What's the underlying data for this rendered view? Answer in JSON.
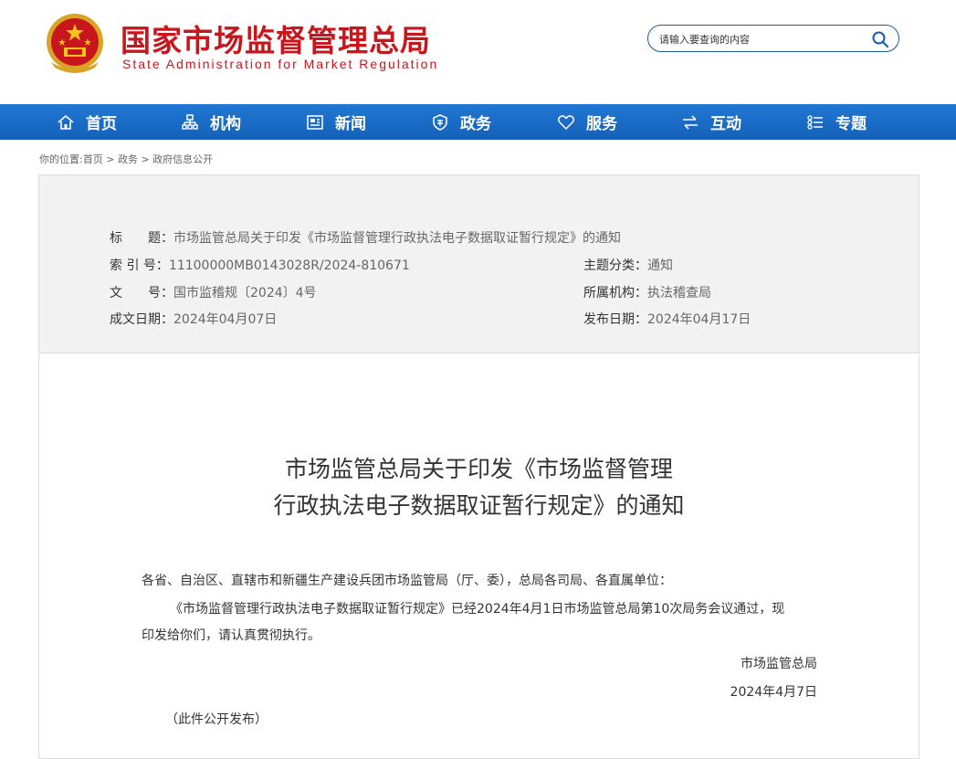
{
  "header": {
    "title_cn": "国家市场监督管理总局",
    "title_en": "State Administration for Market Regulation",
    "search_placeholder": "请输入要查询的内容"
  },
  "nav": [
    {
      "label": "首页",
      "icon": "home-icon"
    },
    {
      "label": "机构",
      "icon": "org-chart-icon"
    },
    {
      "label": "新闻",
      "icon": "newspaper-icon"
    },
    {
      "label": "政务",
      "icon": "shield-icon"
    },
    {
      "label": "服务",
      "icon": "heart-icon"
    },
    {
      "label": "互动",
      "icon": "swap-arrows-icon"
    },
    {
      "label": "专题",
      "icon": "list-icon"
    }
  ],
  "breadcrumb": {
    "prefix": "你的位置:",
    "items": [
      "首页",
      "政务",
      "政府信息公开"
    ],
    "separator": ">"
  },
  "meta": {
    "title_label": "标　　题：",
    "title_value": "市场监管总局关于印发《市场监督管理行政执法电子数据取证暂行规定》的通知",
    "index_label": "索 引 号：",
    "index_value": "11100000MB0143028R/2024-810671",
    "topic_label": "主题分类：",
    "topic_value": "通知",
    "docno_label": "文　　号：",
    "docno_value": "国市监稽规〔2024〕4号",
    "org_label": "所属机构：",
    "org_value": "执法稽查局",
    "created_label": "成文日期：",
    "created_value": "2024年04月07日",
    "published_label": "发布日期：",
    "published_value": "2024年04月17日"
  },
  "document": {
    "title_line1": "市场监管总局关于印发《市场监督管理",
    "title_line2": "行政执法电子数据取证暂行规定》的通知",
    "salutation": "各省、自治区、直辖市和新疆生产建设兵团市场监管局（厅、委），总局各司局、各直属单位：",
    "para1_line1": "《市场监督管理行政执法电子数据取证暂行规定》已经2024年4月1日市场监管总局第10次局务会议通过，现",
    "para1_line2": "印发给你们，请认真贯彻执行。",
    "signature": "市场监管总局",
    "date": "2024年4月7日",
    "note": "（此件公开发布）"
  }
}
